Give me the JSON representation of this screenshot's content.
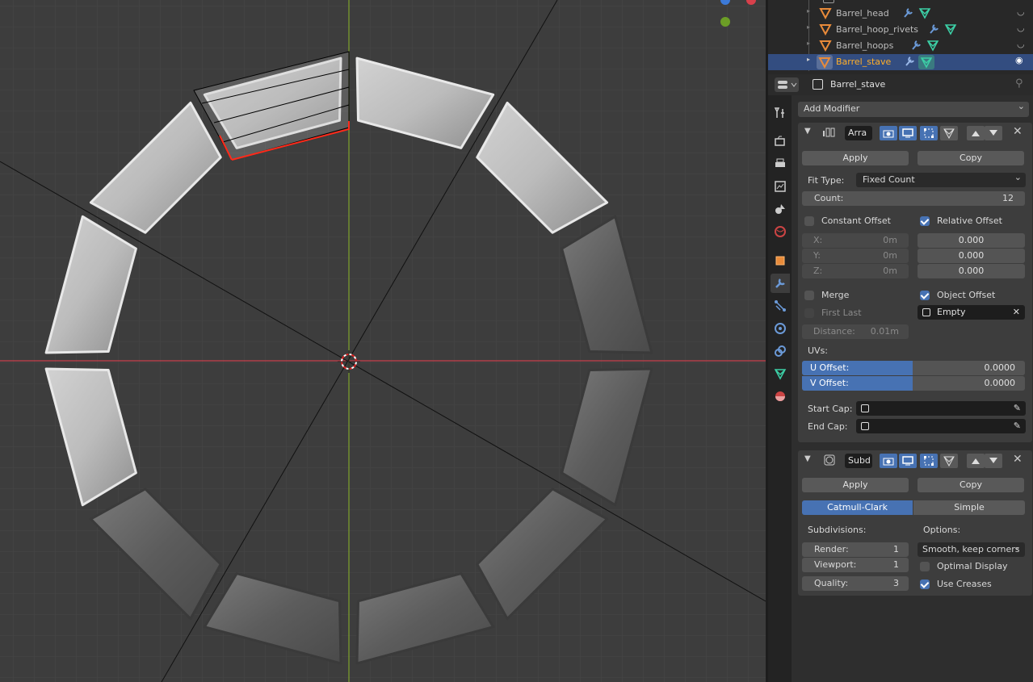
{
  "outliner": {
    "items": [
      {
        "name": "Barrel_head",
        "selected": false
      },
      {
        "name": "Barrel_hoop_rivets",
        "selected": false
      },
      {
        "name": "Barrel_hoops",
        "selected": false
      },
      {
        "name": "Barrel_stave",
        "selected": true
      }
    ]
  },
  "properties": {
    "object_name": "Barrel_stave",
    "add_modifier": "Add Modifier"
  },
  "array_modifier": {
    "name": "Arra",
    "apply": "Apply",
    "copy": "Copy",
    "fit_type_label": "Fit Type:",
    "fit_type_value": "Fixed Count",
    "count_label": "Count:",
    "count_value": "12",
    "constant_offset": {
      "label": "Constant Offset",
      "checked": false
    },
    "relative_offset": {
      "label": "Relative Offset",
      "checked": true
    },
    "constant_x_label": "X:",
    "constant_x": "0m",
    "constant_y_label": "Y:",
    "constant_y": "0m",
    "constant_z_label": "Z:",
    "constant_z": "0m",
    "relative_x": "0.000",
    "relative_y": "0.000",
    "relative_z": "0.000",
    "merge": {
      "label": "Merge",
      "checked": false
    },
    "object_offset": {
      "label": "Object Offset",
      "checked": true
    },
    "first_last": {
      "label": "First Last",
      "checked": false
    },
    "offset_object": "Empty",
    "distance_label": "Distance:",
    "distance_value": "0.01m",
    "uvs_label": "UVs:",
    "u_offset_label": "U Offset:",
    "u_offset_value": "0.0000",
    "v_offset_label": "V Offset:",
    "v_offset_value": "0.0000",
    "start_cap_label": "Start Cap:",
    "end_cap_label": "End Cap:"
  },
  "subsurf_modifier": {
    "name": "Subd",
    "apply": "Apply",
    "copy": "Copy",
    "catmull": "Catmull-Clark",
    "simple": "Simple",
    "subdivisions_label": "Subdivisions:",
    "options_label": "Options:",
    "render_label": "Render:",
    "render_value": "1",
    "viewport_label": "Viewport:",
    "viewport_value": "1",
    "quality_label": "Quality:",
    "quality_value": "3",
    "uv_smooth": "Smooth, keep corners",
    "optimal_display": {
      "label": "Optimal Display",
      "checked": false
    },
    "use_creases": {
      "label": "Use Creases",
      "checked": true
    }
  },
  "colors": {
    "viewport_bg": "#3d3d3d",
    "grid": "#474747",
    "x_axis": "#c9404b",
    "y_axis": "#7ea42b",
    "selection_outline": "#ff2a1a",
    "accent_blue": "#4772b3",
    "highlight_orange": "#ffaf29"
  }
}
